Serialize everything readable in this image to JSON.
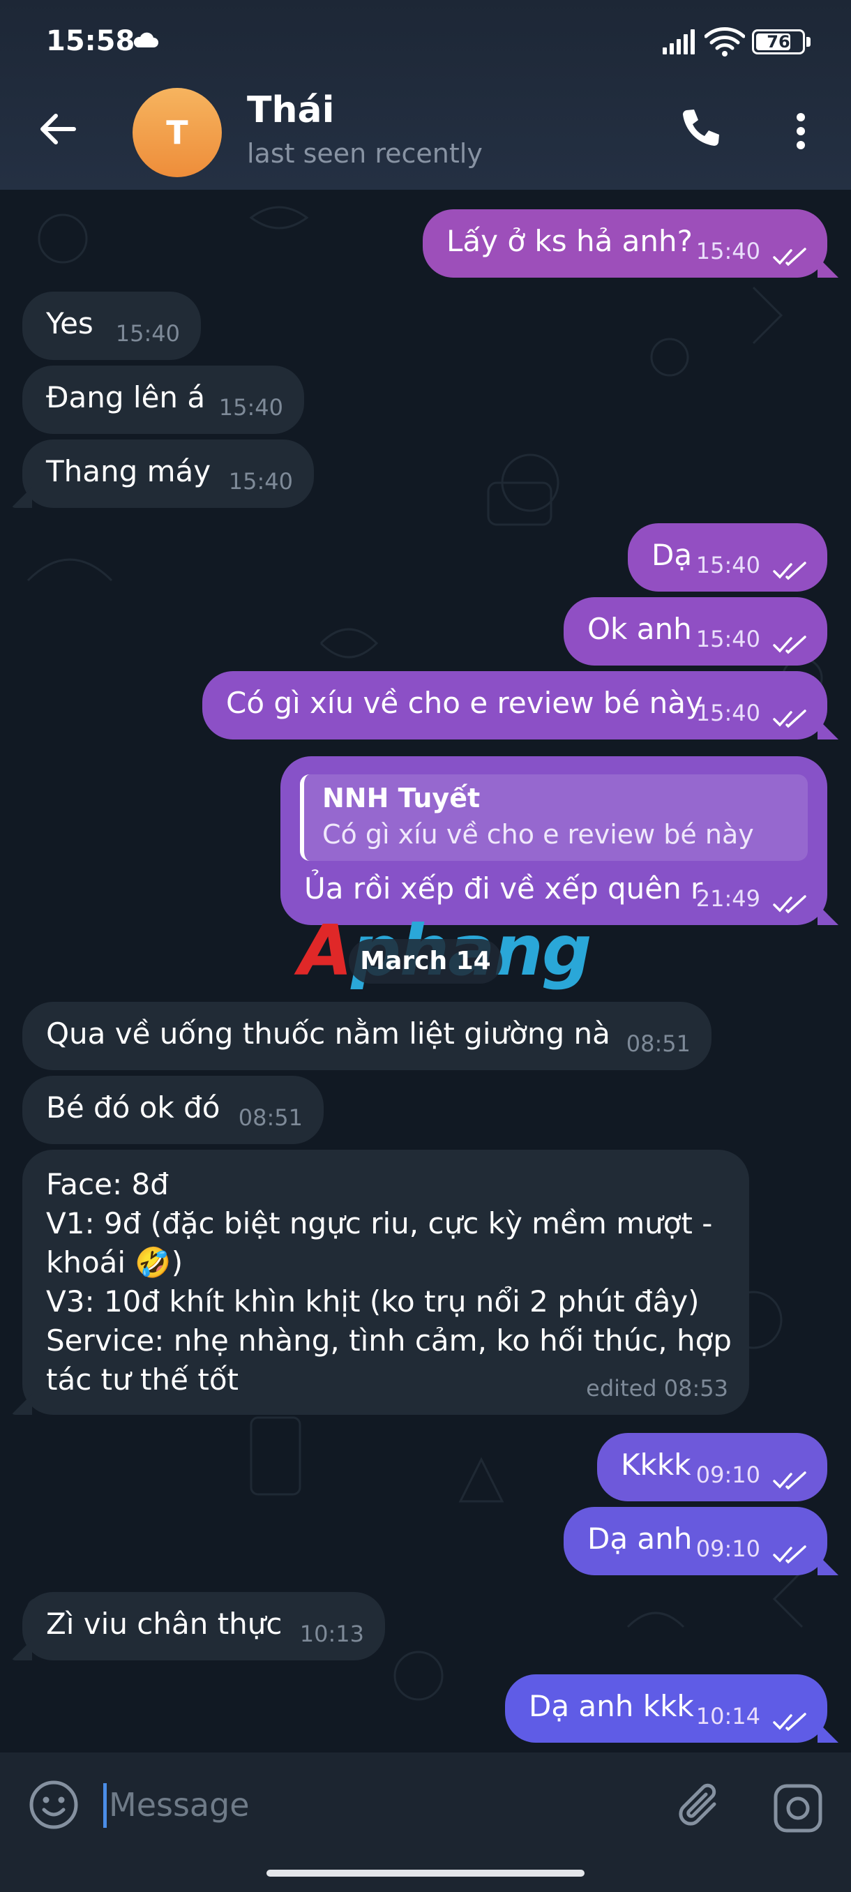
{
  "status_bar": {
    "time": "15:58",
    "battery": "76",
    "battery_level": 76
  },
  "header": {
    "back_icon": "arrow-left-icon",
    "avatar_letter": "T",
    "contact_name": "Thái",
    "status": "last seen recently",
    "call_icon": "phone-icon",
    "menu_icon": "more-vertical-icon"
  },
  "messages": [
    {
      "dir": "out",
      "text": "Lấy ở ks hả anh?",
      "time": "15:40"
    },
    {
      "dir": "in",
      "text": "Yes",
      "time": "15:40"
    },
    {
      "dir": "in",
      "text": "Đang lên á",
      "time": "15:40"
    },
    {
      "dir": "in",
      "text": "Thang máy",
      "time": "15:40"
    },
    {
      "dir": "out",
      "text": "Dạ",
      "time": "15:40"
    },
    {
      "dir": "out",
      "text": "Ok anh",
      "time": "15:40"
    },
    {
      "dir": "out",
      "text": "Có gì xíu về cho e review bé này",
      "time": "15:40"
    },
    {
      "dir": "out",
      "text": "Ủa rồi xếp đi về xếp quên r",
      "time": "21:49",
      "reply": {
        "name": "NNH Tuyết",
        "text": "Có gì xíu về cho e review bé này"
      }
    },
    {
      "dir": "in",
      "text": "Qua về uống thuốc nằm liệt giường nà",
      "time": "08:51"
    },
    {
      "dir": "in",
      "text": "Bé đó ok đó",
      "time": "08:51"
    },
    {
      "dir": "in",
      "text": "Face: 8đ\nV1: 9đ (đặc biệt ngực riu, cực kỳ mềm mượt -\nkhoái 🤣)\nV3: 10đ khít khìn khịt (ko trụ nổi 2 phút đây)\nService: nhẹ nhàng, tình cảm, ko hối thúc, hợp\ntác tư thế tốt",
      "time": "edited 08:53"
    },
    {
      "dir": "out",
      "text": "Kkkk",
      "time": "09:10"
    },
    {
      "dir": "out",
      "text": "Dạ anh",
      "time": "09:10"
    },
    {
      "dir": "in",
      "text": "Zì viu chân thực",
      "time": "10:13"
    },
    {
      "dir": "out",
      "text": "Dạ anh kkk",
      "time": "10:14"
    }
  ],
  "date_divider": "March 14",
  "watermark": {
    "part1": "A",
    "part2": "phang"
  },
  "composer": {
    "placeholder": "Message",
    "emoji_icon": "emoji-smile-icon",
    "attach_icon": "paperclip-icon",
    "camera_icon": "camera-icon"
  },
  "colors": {
    "header_bg": "#1d2736",
    "chat_bg": "#111923",
    "incoming_bubble": "#212b36",
    "outgoing_top": "#9a4fbd",
    "outgoing_bottom": "#5f5ce6",
    "accent": "#4b8ee8"
  }
}
